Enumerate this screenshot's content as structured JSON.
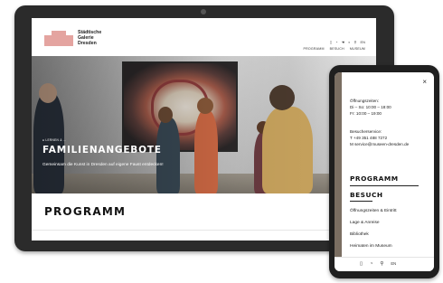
{
  "tablet": {
    "logo": {
      "line1": "Städtische",
      "line2": "Galerie",
      "line3": "Dresden"
    },
    "header_icons": [
      "building-icon",
      "accessibility-icon",
      "sign-language-icon",
      "easy-language-icon",
      "search-icon"
    ],
    "header_icon_glyphs": [
      "▯",
      "◔",
      "☚",
      "◐",
      "⚲"
    ],
    "language": "EN",
    "nav": [
      "PROGRAMM",
      "BESUCH",
      "MUSEUM"
    ],
    "hero": {
      "breadcrumb": "● LERNEN & ...",
      "title": "FAMILIENANGEBOTE",
      "subtitle": "Gemeinsam die Kunst in Dresden auf eigene Faust entdecken!"
    },
    "section_title": "PROGRAMM"
  },
  "phone": {
    "close_glyph": "×",
    "hours": {
      "label": "Öffnungszeiten:",
      "lines": [
        "Di – So: 10:00 – 18:00",
        "Fr: 10:00 – 19:00"
      ]
    },
    "contact": {
      "label": "Besucherservice:",
      "phone": "T   +49 351 488 7272",
      "mail": "M   service@museen-dresden.de"
    },
    "menu": {
      "programm": "PROGRAMM",
      "besuch": "BESUCH",
      "sub_items": [
        "Öffnungszeiten & Eintritt",
        "Lage & Anreise",
        "Bibliothek",
        "Heimaten im Museum"
      ]
    },
    "footer": {
      "icon_glyphs": [
        "▯",
        "◔",
        "⚲"
      ],
      "language": "EN"
    }
  },
  "colors": {
    "logo_pink": "#e4a4a0",
    "device_frame": "#2b2b2b"
  }
}
